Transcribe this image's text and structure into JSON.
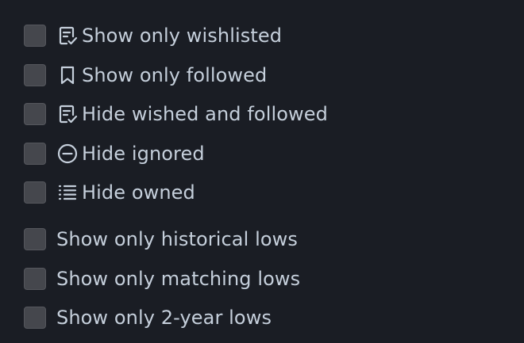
{
  "filters": {
    "icon_filters": [
      {
        "label": "Show only wishlisted",
        "icon": "wishlist-icon",
        "checked": false
      },
      {
        "label": "Show only followed",
        "icon": "bookmark-icon",
        "checked": false
      },
      {
        "label": "Hide wished and followed",
        "icon": "wishlist-icon",
        "checked": false
      },
      {
        "label": "Hide ignored",
        "icon": "minus-circle-icon",
        "checked": false
      },
      {
        "label": "Hide owned",
        "icon": "list-icon",
        "checked": false
      }
    ],
    "low_filters": [
      {
        "label": "Show only historical lows",
        "checked": false
      },
      {
        "label": "Show only matching lows",
        "checked": false
      },
      {
        "label": "Show only 2-year lows",
        "checked": false
      }
    ]
  },
  "colors": {
    "background": "#1a1d24",
    "text": "#c5cfdb",
    "checkbox": "#45474d"
  }
}
